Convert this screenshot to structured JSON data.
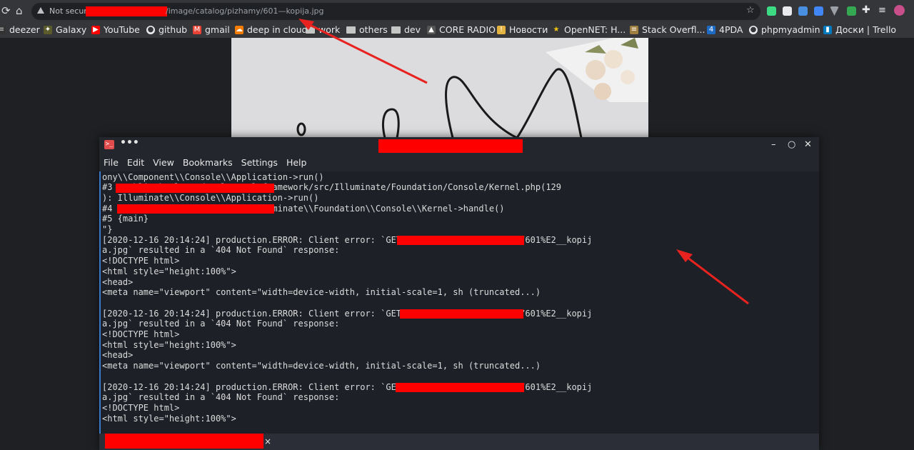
{
  "browser": {
    "security_label": "Not secure",
    "url_path": "/image/catalog/pizhamy/601—kopija.jpg",
    "bookmarks": [
      {
        "label": "deezer"
      },
      {
        "label": "Galaxy"
      },
      {
        "label": "YouTube"
      },
      {
        "label": "github"
      },
      {
        "label": "gmail"
      },
      {
        "label": "deep in cloud"
      },
      {
        "label": "work"
      },
      {
        "label": "others"
      },
      {
        "label": "dev"
      },
      {
        "label": "CORE RADIO"
      },
      {
        "label": "Новости"
      },
      {
        "label": "OpenNET: H..."
      },
      {
        "label": "Stack Overfl..."
      },
      {
        "label": "4PDA"
      },
      {
        "label": "phpmyadmin"
      },
      {
        "label": "Доски | Trello"
      }
    ],
    "colors": {
      "chrome": "#35363a",
      "redaction": "#ff0000",
      "arrow": "#e8231f"
    }
  },
  "terminal": {
    "menu": [
      "File",
      "Edit",
      "View",
      "Bookmarks",
      "Settings",
      "Help"
    ],
    "lines": [
      "ony\\\\Component\\\\Console\\\\Application->run()",
      "#3 /public_html/vendor/laravel/framework/src/Illuminate/Foundation/Console/Kernel.php(129",
      "): Illuminate\\\\Console\\\\Application->run()",
      "#4 /public_html/artisan(37): Illuminate\\\\Foundation\\\\Console\\\\Kernel->handle()",
      "#5 {main}",
      "\"}",
      "[2020-12-16 20:14:24] production.ERROR: Client error: `GET /image/catalog/pizhamy/601%E2__kopij",
      "a.jpg` resulted in a `404 Not Found` response:",
      "<!DOCTYPE html>",
      "<html style=\"height:100%\">",
      "<head>",
      "<meta name=\"viewport\" content=\"width=device-width, initial-scale=1, sh (truncated...)",
      "",
      "[2020-12-16 20:14:24] production.ERROR: Client error: `GET /image/catalog/pizhamy/601%E2__kopij",
      "a.jpg` resulted in a `404 Not Found` response:",
      "<!DOCTYPE html>",
      "<html style=\"height:100%\">",
      "<head>",
      "<meta name=\"viewport\" content=\"width=device-width, initial-scale=1, sh (truncated...)",
      "",
      "[2020-12-16 20:14:24] production.ERROR: Client error: `GET /image/catalog/pizhamy/601%E2__kopij",
      "a.jpg` resulted in a `404 Not Found` response:",
      "<!DOCTYPE html>",
      "<html style=\"height:100%\">"
    ],
    "tab_close": "×",
    "window_buttons": {
      "minimize": "–",
      "maximize": "○",
      "close": "✕"
    },
    "dots": "•••"
  }
}
